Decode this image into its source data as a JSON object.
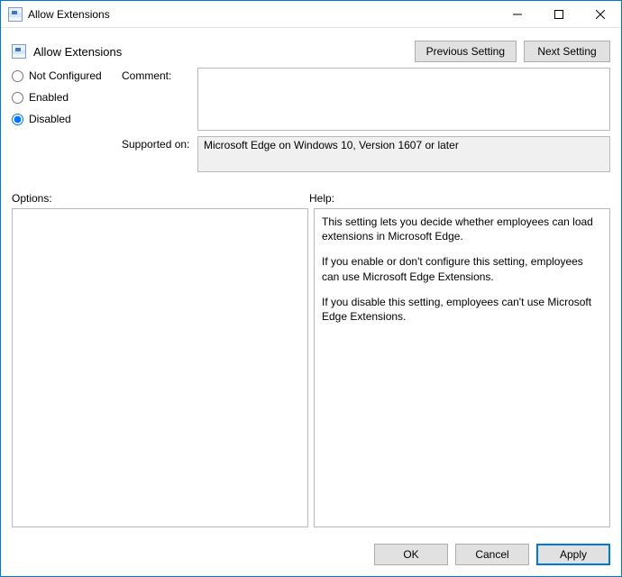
{
  "window": {
    "title": "Allow Extensions"
  },
  "header": {
    "title": "Allow Extensions",
    "previous": "Previous Setting",
    "next": "Next Setting"
  },
  "radios": {
    "not_configured": "Not Configured",
    "enabled": "Enabled",
    "disabled": "Disabled",
    "selected": "disabled"
  },
  "labels": {
    "comment": "Comment:",
    "supported_on": "Supported on:",
    "options": "Options:",
    "help": "Help:"
  },
  "fields": {
    "comment": "",
    "supported_on": "Microsoft Edge on Windows 10, Version 1607 or later"
  },
  "help": {
    "p1": "This setting lets you decide whether employees can load extensions in Microsoft Edge.",
    "p2": "If you enable or don't configure this setting, employees can use Microsoft Edge Extensions.",
    "p3": "If you disable this setting, employees can't use Microsoft Edge Extensions."
  },
  "footer": {
    "ok": "OK",
    "cancel": "Cancel",
    "apply": "Apply"
  }
}
